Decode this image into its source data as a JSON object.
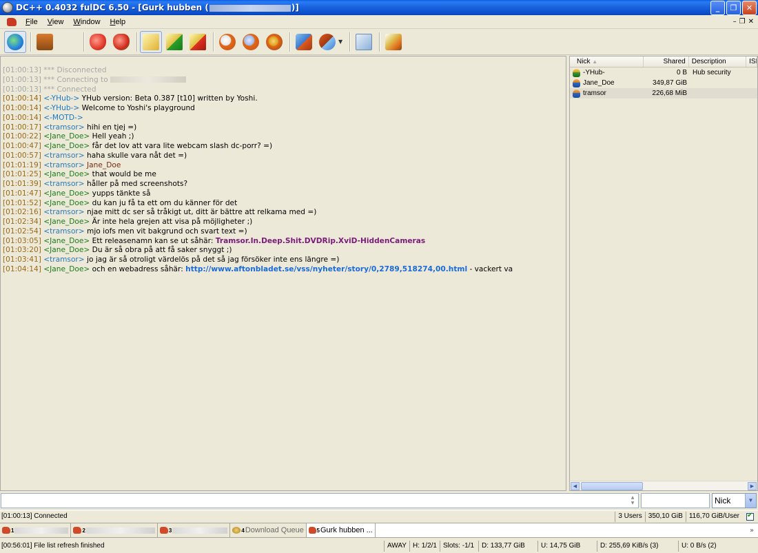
{
  "window": {
    "title_prefix": "DC++ 0.4032 fulDC 6.50 - [Gurk hubben (",
    "title_suffix": ")]",
    "minimize": "_",
    "maximize": "❐",
    "close": "✕"
  },
  "menu": {
    "items": [
      "File",
      "View",
      "Window",
      "Help"
    ],
    "mdi": [
      "–",
      "❐",
      "✕"
    ]
  },
  "chat": {
    "lines": [
      {
        "ts": "[01:00:13]",
        "type": "sys",
        "text": "*** Disconnected"
      },
      {
        "ts": "[01:00:13]",
        "type": "sys",
        "text": "*** Connecting to"
      },
      {
        "ts": "[01:00:13]",
        "type": "sys",
        "text": "*** Connected"
      },
      {
        "ts": "[01:00:14]",
        "type": "hub",
        "nick": "<-YHub->",
        "text": "YHub version: Beta 0.387 [t10] written by Yoshi."
      },
      {
        "ts": "[01:00:14]",
        "type": "hub",
        "nick": "<-YHub->",
        "text": "Welcome to Yoshi's playground"
      },
      {
        "ts": "[01:00:14]",
        "type": "hub",
        "nick": "<-MOTD->",
        "text": ""
      },
      {
        "ts": "[01:00:17]",
        "type": "tram",
        "nick": "<tramsor>",
        "text": "hihi en tjej =)"
      },
      {
        "ts": "[01:00:22]",
        "type": "jane",
        "nick": "<Jane_Doe>",
        "text": "Hell yeah ;)"
      },
      {
        "ts": "[01:00:47]",
        "type": "jane",
        "nick": "<Jane_Doe>",
        "text": "får det lov att vara lite webcam slash dc-porr? =)"
      },
      {
        "ts": "[01:00:57]",
        "type": "tram",
        "nick": "<tramsor>",
        "text": "haha skulle vara nåt det =)"
      },
      {
        "ts": "[01:01:19]",
        "type": "tram",
        "nick": "<tramsor>",
        "mention": "Jane_Doe",
        "text": ""
      },
      {
        "ts": "[01:01:25]",
        "type": "jane",
        "nick": "<Jane_Doe>",
        "text": "that would be me"
      },
      {
        "ts": "[01:01:39]",
        "type": "tram",
        "nick": "<tramsor>",
        "text": "håller på med screenshots?"
      },
      {
        "ts": "[01:01:47]",
        "type": "jane",
        "nick": "<Jane_Doe>",
        "text": "yupps tänkte så"
      },
      {
        "ts": "[01:01:52]",
        "type": "jane",
        "nick": "<Jane_Doe>",
        "text": "du kan ju få ta ett om du känner för det"
      },
      {
        "ts": "[01:02:16]",
        "type": "tram",
        "nick": "<tramsor>",
        "text": "njae mitt dc ser så tråkigt ut, ditt är bättre att relkama med =)"
      },
      {
        "ts": "[01:02:34]",
        "type": "jane",
        "nick": "<Jane_Doe>",
        "text": "Är inte hela grejen att visa på möjligheter ;)"
      },
      {
        "ts": "[01:02:54]",
        "type": "tram",
        "nick": "<tramsor>",
        "text": "mjo iofs men vit bakgrund och svart text =)"
      },
      {
        "ts": "[01:03:05]",
        "type": "jane",
        "nick": "<Jane_Doe>",
        "text": "Ett releasenamn kan se ut såhär:",
        "release": "Tramsor.In.Deep.Shit.DVDRip.XviD-HiddenCameras"
      },
      {
        "ts": "[01:03:20]",
        "type": "jane",
        "nick": "<Jane_Doe>",
        "text": "Du är så obra på att få saker snyggt ;)"
      },
      {
        "ts": "[01:03:41]",
        "type": "tram",
        "nick": "<tramsor>",
        "text": "jo jag är så otroligt värdelös på det så jag försöker inte ens längre =)"
      },
      {
        "ts": "[01:04:14]",
        "type": "jane",
        "nick": "<Jane_Doe>",
        "text": "och en webadress såhär:",
        "url": "http://www.aftonbladet.se/vss/nyheter/story/0,2789,518274,00.html",
        "after": "- vackert va"
      }
    ]
  },
  "userlist": {
    "columns": {
      "nick": "Nick",
      "shared": "Shared",
      "description": "Description",
      "isp": "ISI"
    },
    "users": [
      {
        "nick": "-YHub-",
        "shared": "0 B",
        "description": "Hub security",
        "op": true
      },
      {
        "nick": "Jane_Doe",
        "shared": "349,87 GiB",
        "description": "",
        "op": false
      },
      {
        "nick": "tramsor",
        "shared": "226,68 MiB",
        "description": "",
        "op": false
      }
    ]
  },
  "input": {
    "message_value": "",
    "filter_value": "",
    "filter_column": "Nick"
  },
  "hubstatus": {
    "message": "[01:00:13] Connected",
    "users": "3 Users",
    "shared": "350,10 GiB",
    "per_user": "116,70 GiB/User"
  },
  "tabs": [
    {
      "num": "1",
      "label": "",
      "redacted": true,
      "w": 78
    },
    {
      "num": "2",
      "label": "",
      "redacted": true,
      "w": 100
    },
    {
      "num": "3",
      "label": "",
      "redacted": true,
      "w": 80
    },
    {
      "num": "4",
      "label": "Download Queue",
      "redacted": false
    },
    {
      "num": "5",
      "label": "Gurk hubben ...",
      "redacted": false,
      "active": true
    }
  ],
  "statusbar": {
    "message": "[00:56:01] File list refresh finished",
    "away": "AWAY",
    "hubs": "H: 1/2/1",
    "slots": "Slots: -1/1",
    "downloaded": "D: 133,77 GiB",
    "uploaded": "U: 14,75 GiB",
    "down_speed": "D: 255,69 KiB/s (3)",
    "up_speed": "U: 0 B/s (2)"
  }
}
